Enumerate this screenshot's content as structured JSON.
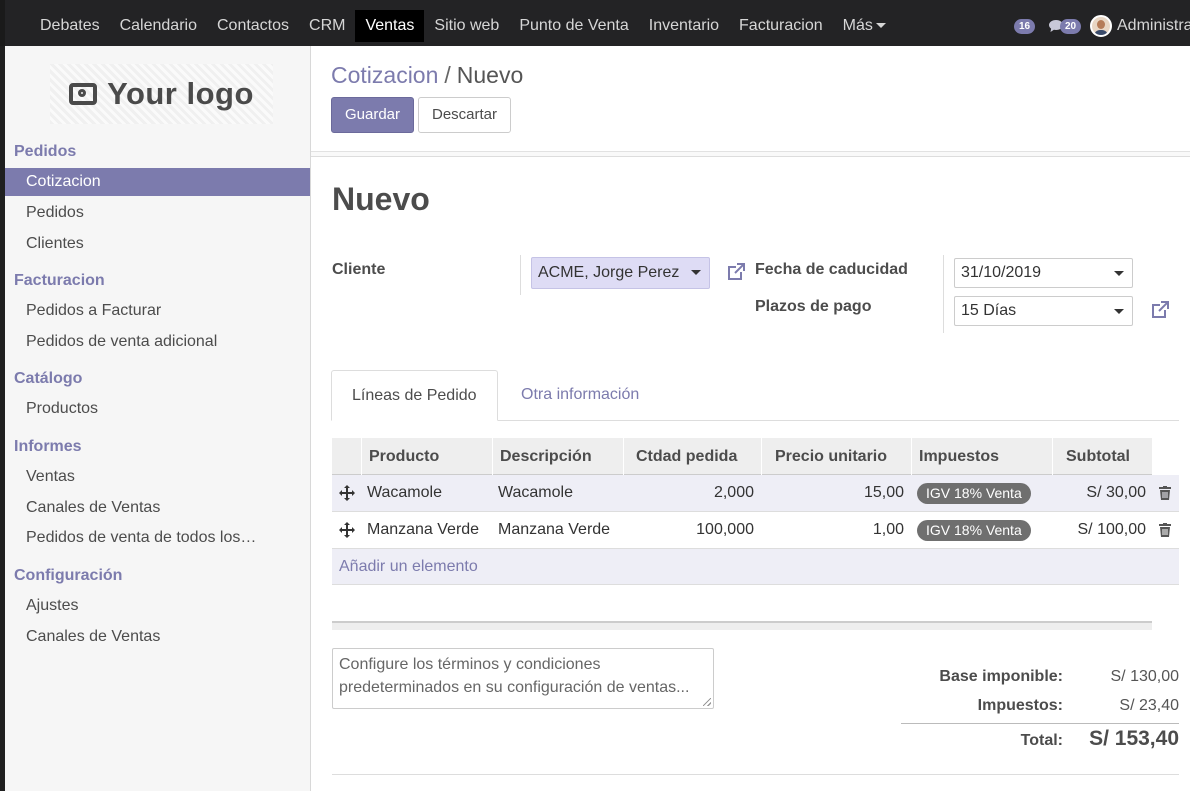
{
  "topbar": {
    "menu": [
      "Debates",
      "Calendario",
      "Contactos",
      "CRM",
      "Ventas",
      "Sitio web",
      "Punto de Venta",
      "Inventario",
      "Facturacion",
      "Más"
    ],
    "active": "Ventas",
    "messages_count": "16",
    "chat_count": "20",
    "user": "Administrat"
  },
  "logo": {
    "text": "Your logo"
  },
  "sidebar": {
    "sections": [
      {
        "title": "Pedidos",
        "items": [
          "Cotizacion",
          "Pedidos",
          "Clientes"
        ]
      },
      {
        "title": "Facturacion",
        "items": [
          "Pedidos a Facturar",
          "Pedidos de venta adicional"
        ]
      },
      {
        "title": "Catálogo",
        "items": [
          "Productos"
        ]
      },
      {
        "title": "Informes",
        "items": [
          "Ventas",
          "Canales de Ventas",
          "Pedidos de venta de todos los…"
        ]
      },
      {
        "title": "Configuración",
        "items": [
          "Ajustes",
          "Canales de Ventas"
        ]
      }
    ],
    "active_item": "Cotizacion"
  },
  "breadcrumb": {
    "parent": "Cotizacion",
    "separator": "/",
    "current": "Nuevo"
  },
  "buttons": {
    "save": "Guardar",
    "discard": "Descartar"
  },
  "form": {
    "title": "Nuevo",
    "cliente_label": "Cliente",
    "cliente_value": "ACME, Jorge Perez",
    "fecha_label": "Fecha de caducidad",
    "fecha_value": "31/10/2019",
    "plazos_label": "Plazos de pago",
    "plazos_value": "15 Días"
  },
  "tabs": [
    "Líneas de Pedido",
    "Otra información"
  ],
  "lines": {
    "headers": [
      "Producto",
      "Descripción",
      "Ctdad pedida",
      "Precio unitario",
      "Impuestos",
      "Subtotal"
    ],
    "rows": [
      {
        "producto": "Wacamole",
        "descripcion": "Wacamole",
        "cantidad": "2,000",
        "precio": "15,00",
        "impuesto": "IGV 18% Venta",
        "subtotal": "S/ 30,00"
      },
      {
        "producto": "Manzana Verde",
        "descripcion": "Manzana Verde",
        "cantidad": "100,000",
        "precio": "1,00",
        "impuesto": "IGV 18% Venta",
        "subtotal": "S/ 100,00"
      }
    ],
    "add": "Añadir un elemento"
  },
  "note_placeholder": "Configure los términos y condiciones predeterminados en su configuración de ventas...",
  "totals": {
    "base_label": "Base imponible:",
    "base_value": "S/ 130,00",
    "tax_label": "Impuestos:",
    "tax_value": "S/ 23,40",
    "total_label": "Total:",
    "total_value": "S/ 153,40"
  },
  "colors": {
    "accent": "#7c7bad",
    "topbar": "#232325",
    "tag": "#6f6f6f"
  }
}
